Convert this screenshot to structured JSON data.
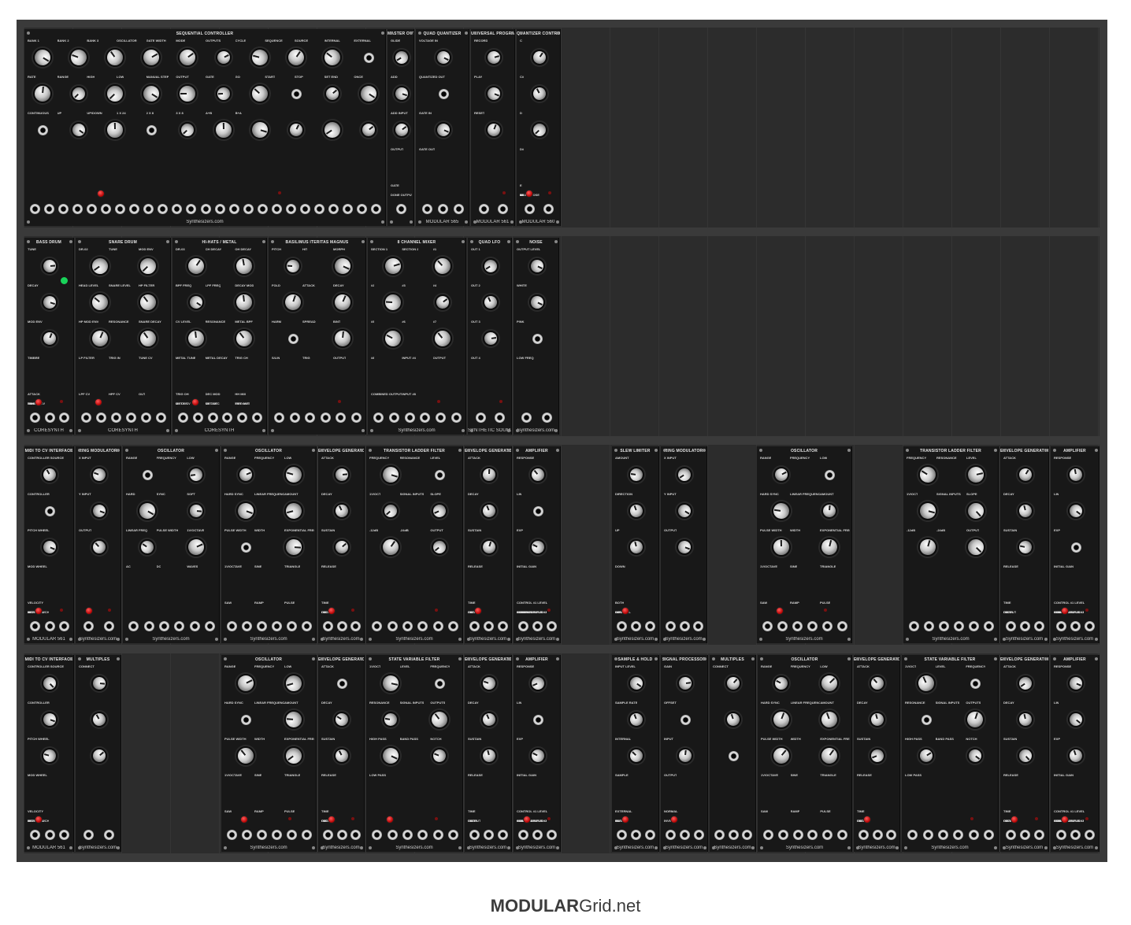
{
  "footer": {
    "brand_bold": "MODULAR",
    "brand_rest": "Grid.net"
  },
  "rows": [
    {
      "modules": [
        {
          "title": "SEQUENTIAL CONTROLLER",
          "brand": "Synthesizers.com",
          "labels": [
            "BANK 1",
            "BANK 2",
            "BANK 3",
            "OSCILLATOR",
            "GATE WIDTH",
            "MODE",
            "OUTPUTS",
            "CYCLE",
            "SEQUENCE",
            "SOURCE",
            "INTERNAL",
            "EXTERNAL",
            "RATE",
            "RANGE",
            "HIGH",
            "LOW",
            "MANUAL STEP",
            "OUTPUT",
            "GATE",
            "GO",
            "START",
            "STOP",
            "SET END",
            "ONCE",
            "CONTINUOUS",
            "UP",
            "UP/DOWN",
            "1 X 24",
            "2 X 8",
            "3 X 8",
            "A+B",
            "B+A"
          ]
        },
        {
          "title": "MASTER OUTPUT",
          "brand": "",
          "labels": [
            "GLIDE",
            "ADD",
            "ADD INPUT",
            "OUTPUT",
            "GATE",
            "DONE OUTPUT"
          ]
        },
        {
          "title": "QUAD QUANTIZER",
          "brand": "MODULAR 565",
          "labels": [
            "VOLTAGE IN",
            "QUANTIZED OUT",
            "GATE IN",
            "GATE OUT"
          ]
        },
        {
          "title": "UNIVERSAL PROGRAMMER",
          "brand": "MODULAR 561",
          "labels": [
            "RECORD",
            "PLAY",
            "RESET"
          ]
        },
        {
          "title": "QUANTIZER CONTROLLER",
          "brand": "MODULAR 560",
          "labels": [
            "C",
            "C#",
            "D",
            "D#",
            "E",
            "F",
            "F#",
            "G",
            "G#",
            "A",
            "A#",
            "B",
            "TRANSPOSE"
          ]
        }
      ]
    },
    {
      "modules": [
        {
          "title": "BASS DRUM",
          "brand": "CORESYNTH",
          "labels": [
            "TUNE",
            "DECAY",
            "MOD ENV",
            "TIMBRE",
            "ATTACK",
            "TUNE CV",
            "TIMBRE CV",
            "TRIG IN",
            "BD OUT"
          ]
        },
        {
          "title": "SNARE DRUM",
          "brand": "CORESYNTH",
          "labels": [
            "DR-02",
            "TUNE",
            "MOD ENV",
            "HEAD LEVEL",
            "SNARE LEVEL",
            "HP FILTER",
            "HP MOD ENV",
            "RESONANCE",
            "SNARE DECAY",
            "LP FILTER",
            "TRIG IN",
            "TUNE CV",
            "LPF CV",
            "HPF CV",
            "OUT"
          ]
        },
        {
          "title": "HI-HATS / METAL",
          "brand": "CORESYNTH",
          "labels": [
            "DR-03",
            "CH DECAY",
            "OH DECAY",
            "BPF FREQ",
            "LPF FREQ",
            "DECAY MOD",
            "CV LEVEL",
            "RESONANCE",
            "METAL BPF",
            "METAL TUNE",
            "METAL DECAY",
            "TRIG CH",
            "TRIG OH",
            "DEC MOD",
            "HH MIX",
            "MET F CV",
            "MET DEC",
            "TRIG MET",
            "OH OUT",
            "CH OUT",
            "MET OUT"
          ]
        },
        {
          "title": "BASILIMUS ITERITAS MAGNUS",
          "brand": "",
          "labels": [
            "PITCH",
            "HIT",
            "MORPH",
            "FOLD",
            "ATTACK",
            "DECAY",
            "HARM",
            "SPREAD",
            "B/NT",
            "S/LIN",
            "TRIG",
            "OUTPUT"
          ]
        },
        {
          "title": "8 CHANNEL MIXER",
          "brand": "Synthesizers.com",
          "labels": [
            "SECTION 1",
            "SECTION 2",
            "#1",
            "#2",
            "#3",
            "#4",
            "#5",
            "#6",
            "#7",
            "#8",
            "INPUT #4",
            "OUTPUT",
            "COMBINED OUTPUT",
            "INPUT #8"
          ]
        },
        {
          "title": "QUAD LFO",
          "brand": "SYNTHETIC SOUND LABS",
          "labels": [
            "OUT 1",
            "OUT 2",
            "OUT 3",
            "OUT 4"
          ]
        },
        {
          "title": "NOISE",
          "brand": "Synthesizers.com",
          "labels": [
            "OUTPUT LEVEL",
            "WHITE",
            "PINK",
            "LOW FREQ"
          ]
        }
      ]
    },
    {
      "modules": [
        {
          "title": "MIDI TO CV INTERFACE",
          "brand": "MODULAR 561",
          "labels": [
            "CONTROLLER SOURCE",
            "CONTROLLER",
            "PITCH WHEEL",
            "MOD WHEEL",
            "VELOCITY",
            "AFTERTOUCH",
            "MIDI IN",
            "MIDI THRU"
          ]
        },
        {
          "title": "RING MODULATOR",
          "brand": "Synthesizers.com",
          "labels": [
            "X INPUT",
            "Y INPUT",
            "OUTPUT"
          ]
        },
        {
          "title": "OSCILLATOR",
          "brand": "Synthesizers.com",
          "labels": [
            "RANGE",
            "FREQUENCY",
            "LOW",
            "HARD",
            "SYNC",
            "SOFT",
            "LINEAR FREQ",
            "PULSE WIDTH",
            "1V/OCTAVE",
            "AC",
            "DC",
            "WAVES"
          ]
        },
        {
          "title": "OSCILLATOR",
          "brand": "Synthesizers.com",
          "labels": [
            "RANGE",
            "FREQUENCY",
            "LOW",
            "HARD SYNC",
            "LINEAR FREQUENCY",
            "AMOUNT",
            "PULSE WIDTH",
            "WIDTH",
            "EXPONENTIAL FREQUENCY",
            "1V/OCTAVE",
            "SINE",
            "TRIANGLE",
            "SAW",
            "RAMP",
            "PULSE"
          ]
        },
        {
          "title": "ENVELOPE GENERATOR",
          "brand": "Synthesizers.com",
          "labels": [
            "ATTACK",
            "DECAY",
            "SUSTAIN",
            "RELEASE",
            "TIME",
            "LEVEL",
            "GATE",
            "OUTPUT"
          ]
        },
        {
          "title": "TRANSISTOR LADDER FILTER",
          "brand": "Synthesizers.com",
          "labels": [
            "FREQUENCY",
            "RESONANCE",
            "LEVEL",
            "1V/OCT",
            "SIGNAL INPUTS",
            "SLOPE",
            "-12dB",
            "-24dB",
            "OUTPUT"
          ]
        },
        {
          "title": "ENVELOPE GENERATOR",
          "brand": "Synthesizers.com",
          "labels": [
            "ATTACK",
            "DECAY",
            "SUSTAIN",
            "RELEASE",
            "TIME",
            "LEVEL",
            "GATE",
            "OUTPUT"
          ]
        },
        {
          "title": "AMPLIFIER",
          "brand": "Synthesizers.com",
          "labels": [
            "RESPONSE",
            "LIN",
            "EXP",
            "INITIAL GAIN",
            "CONTROL #1 LEVEL",
            "CONTROL INPUT #1",
            "CONTROL INPUT #2",
            "SIGNAL INPUT #1",
            "SIGNAL INPUT #2",
            "- OUTPUT",
            "+ OUTPUT"
          ]
        },
        {
          "title": "SLEW LIMITER",
          "brand": "Synthesizers.com",
          "labels": [
            "AMOUNT",
            "DIRECTION",
            "UP",
            "DOWN",
            "BOTH",
            "ON",
            "CONTROL",
            "INPUT",
            "OUTPUT"
          ]
        },
        {
          "title": "RING MODULATOR",
          "brand": "Synthesizers.com",
          "labels": [
            "X INPUT",
            "Y INPUT",
            "OUTPUT"
          ]
        },
        {
          "title": "OSCILLATOR",
          "brand": "Synthesizers.com",
          "labels": [
            "RANGE",
            "FREQUENCY",
            "LOW",
            "HARD SYNC",
            "LINEAR FREQUENCY",
            "AMOUNT",
            "PULSE WIDTH",
            "WIDTH",
            "EXPONENTIAL FREQUENCY",
            "1V/OCTAVE",
            "SINE",
            "TRIANGLE",
            "SAW",
            "RAMP",
            "PULSE"
          ]
        },
        {
          "title": "TRANSISTOR LADDER FILTER",
          "brand": "Synthesizers.com",
          "labels": [
            "FREQUENCY",
            "RESONANCE",
            "LEVEL",
            "1V/OCT",
            "SIGNAL INPUTS",
            "SLOPE",
            "-12dB",
            "-24dB",
            "OUTPUT"
          ]
        },
        {
          "title": "ENVELOPE GENERATOR",
          "brand": "Synthesizers.com",
          "labels": [
            "ATTACK",
            "DECAY",
            "SUSTAIN",
            "RELEASE",
            "TIME",
            "LEVEL",
            "GATE",
            "OUTPUT"
          ]
        },
        {
          "title": "AMPLIFIER",
          "brand": "Synthesizers.com",
          "labels": [
            "RESPONSE",
            "LIN",
            "EXP",
            "INITIAL GAIN",
            "CONTROL #1 LEVEL",
            "CONTROL INPUT #1",
            "CONTROL INPUT #2",
            "SIGNAL INPUT #1",
            "SIGNAL INPUT #2",
            "- OUTPUT",
            "+ OUTPUT"
          ]
        }
      ]
    },
    {
      "modules": [
        {
          "title": "MIDI TO CV INTERFACE",
          "brand": "MODULAR 561",
          "labels": [
            "CONTROLLER SOURCE",
            "CONTROLLER",
            "PITCH WHEEL",
            "MOD WHEEL",
            "VELOCITY",
            "AFTERTOUCH",
            "MIDI IN",
            "MIDI THRU"
          ]
        },
        {
          "title": "MULTIPLES",
          "brand": "Synthesizers.com",
          "labels": [
            "CONNECT"
          ]
        },
        {
          "title": "OSCILLATOR",
          "brand": "Synthesizers.com",
          "labels": [
            "RANGE",
            "FREQUENCY",
            "LOW",
            "HARD SYNC",
            "LINEAR FREQUENCY",
            "AMOUNT",
            "PULSE WIDTH",
            "WIDTH",
            "EXPONENTIAL FREQUENCY",
            "1V/OCTAVE",
            "SINE",
            "TRIANGLE",
            "SAW",
            "RAMP",
            "PULSE"
          ]
        },
        {
          "title": "ENVELOPE GENERATOR",
          "brand": "Synthesizers.com",
          "labels": [
            "ATTACK",
            "DECAY",
            "SUSTAIN",
            "RELEASE",
            "TIME",
            "LEVEL",
            "GATE",
            "OUTPUT"
          ]
        },
        {
          "title": "STATE VARIABLE FILTER",
          "brand": "Synthesizers.com",
          "labels": [
            "1V/OCT",
            "LEVEL",
            "FREQUENCY",
            "RESONANCE",
            "SIGNAL INPUTS",
            "OUTPUTS",
            "HIGH PASS",
            "BAND PASS",
            "NOTCH",
            "LOW PASS"
          ]
        },
        {
          "title": "ENVELOPE GENERATOR",
          "brand": "Synthesizers.com",
          "labels": [
            "ATTACK",
            "DECAY",
            "SUSTAIN",
            "RELEASE",
            "TIME",
            "LEVEL",
            "GATE",
            "OUTPUT"
          ]
        },
        {
          "title": "AMPLIFIER",
          "brand": "Synthesizers.com",
          "labels": [
            "RESPONSE",
            "LIN",
            "EXP",
            "INITIAL GAIN",
            "CONTROL #1 LEVEL",
            "CONTROL INPUT #1",
            "CONTROL INPUT #2",
            "SIGNAL INPUT #1",
            "SIGNAL INPUT #2",
            "- OUTPUT",
            "+ OUTPUT"
          ]
        },
        {
          "title": "SAMPLE & HOLD",
          "brand": "Synthesizers.com",
          "labels": [
            "INPUT LEVEL",
            "SAMPLE RATE",
            "INTERNAL",
            "SAMPLE",
            "EXTERNAL",
            "GATE",
            "MANUAL",
            "IN",
            "OUT"
          ]
        },
        {
          "title": "SIGNAL PROCESSOR",
          "brand": "Synthesizers.com",
          "labels": [
            "GAIN",
            "OFFSET",
            "INPUT",
            "OUTPUT",
            "NORMAL",
            "INVERT"
          ]
        },
        {
          "title": "MULTIPLES",
          "brand": "Synthesizers.com",
          "labels": [
            "CONNECT"
          ]
        },
        {
          "title": "OSCILLATOR",
          "brand": "Synthesizers.com",
          "labels": [
            "RANGE",
            "FREQUENCY",
            "LOW",
            "HARD SYNC",
            "LINEAR FREQUENCY",
            "AMOUNT",
            "PULSE WIDTH",
            "WIDTH",
            "EXPONENTIAL FREQUENCY",
            "1V/OCTAVE",
            "SINE",
            "TRIANGLE",
            "SAW",
            "RAMP",
            "PULSE"
          ]
        },
        {
          "title": "ENVELOPE GENERATOR",
          "brand": "Synthesizers.com",
          "labels": [
            "ATTACK",
            "DECAY",
            "SUSTAIN",
            "RELEASE",
            "TIME",
            "LEVEL",
            "GATE",
            "OUTPUT"
          ]
        },
        {
          "title": "STATE VARIABLE FILTER",
          "brand": "Synthesizers.com",
          "labels": [
            "1V/OCT",
            "LEVEL",
            "FREQUENCY",
            "RESONANCE",
            "SIGNAL INPUTS",
            "OUTPUTS",
            "HIGH PASS",
            "BAND PASS",
            "NOTCH",
            "LOW PASS"
          ]
        },
        {
          "title": "ENVELOPE GENERATOR",
          "brand": "Synthesizers.com",
          "labels": [
            "ATTACK",
            "DECAY",
            "SUSTAIN",
            "RELEASE",
            "TIME",
            "LEVEL",
            "GATE",
            "OUTPUT"
          ]
        },
        {
          "title": "AMPLIFIER",
          "brand": "Synthesizers.com",
          "labels": [
            "RESPONSE",
            "LIN",
            "EXP",
            "INITIAL GAIN",
            "CONTROL #1 LEVEL",
            "CONTROL INPUT #1",
            "CONTROL INPUT #2",
            "SIGNAL INPUT #1",
            "SIGNAL INPUT #2",
            "- OUTPUT",
            "+ OUTPUT"
          ]
        }
      ]
    }
  ]
}
